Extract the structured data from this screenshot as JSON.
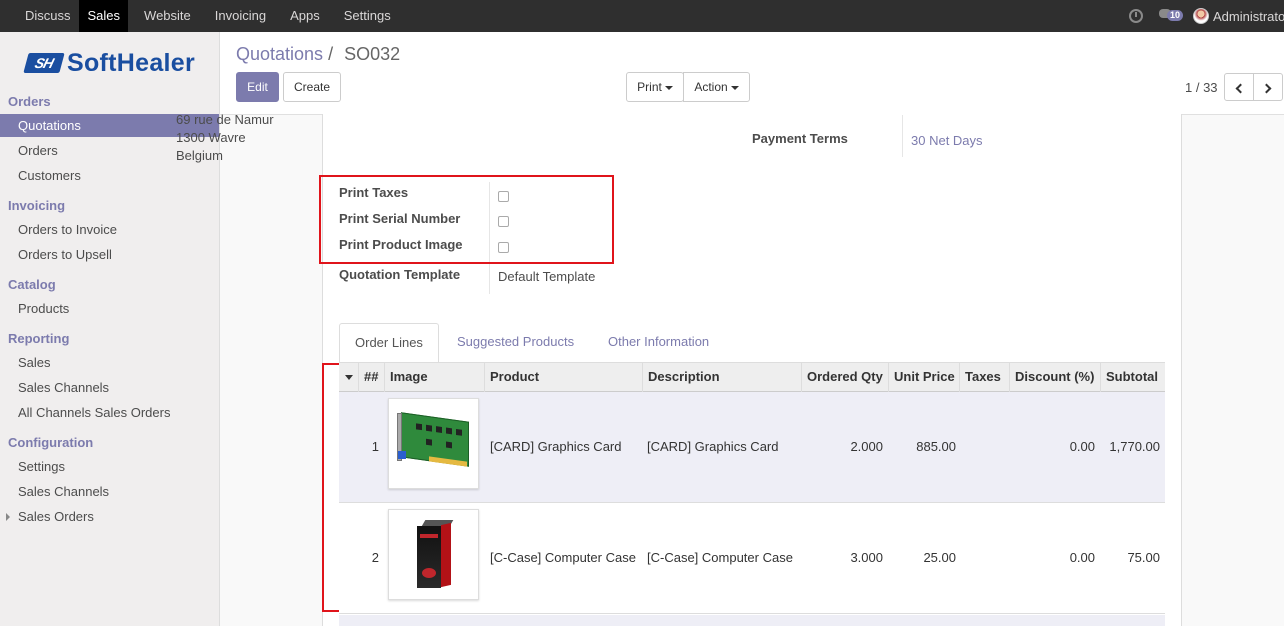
{
  "topbar": {
    "menu": [
      "Discuss",
      "Sales",
      "Website",
      "Invoicing",
      "Apps",
      "Settings"
    ],
    "active": "Sales",
    "chat_count": "10",
    "user": "Administrator"
  },
  "logo": {
    "mark": "SH",
    "text": "SoftHealer"
  },
  "sidebar": {
    "sections": [
      {
        "title": "Orders",
        "items": [
          "Quotations",
          "Orders",
          "Customers"
        ]
      },
      {
        "title": "Invoicing",
        "items": [
          "Orders to Invoice",
          "Orders to Upsell"
        ]
      },
      {
        "title": "Catalog",
        "items": [
          "Products"
        ]
      },
      {
        "title": "Reporting",
        "items": [
          "Sales",
          "Sales Channels",
          "All Channels Sales Orders"
        ]
      },
      {
        "title": "Configuration",
        "items": [
          "Settings",
          "Sales Channels",
          "Sales Orders"
        ]
      }
    ]
  },
  "breadcrumb": {
    "parent": "Quotations",
    "sep": "/",
    "current": "SO032"
  },
  "buttons": {
    "edit": "Edit",
    "create": "Create",
    "print": "Print",
    "action": "Action"
  },
  "pager": {
    "text": "1 / 33"
  },
  "form": {
    "address": [
      "69 rue de Namur",
      "1300 Wavre",
      "Belgium"
    ],
    "payment_terms_label": "Payment Terms",
    "payment_terms_value": "30 Net Days",
    "print_taxes_label": "Print Taxes",
    "print_serial_label": "Print Serial Number",
    "print_image_label": "Print Product Image",
    "template_label": "Quotation Template",
    "template_value": "Default Template"
  },
  "tabs": [
    "Order Lines",
    "Suggested Products",
    "Other Information"
  ],
  "table": {
    "headers": {
      "seq": "##",
      "image": "Image",
      "product": "Product",
      "description": "Description",
      "qty": "Ordered Qty",
      "price": "Unit Price",
      "taxes": "Taxes",
      "discount": "Discount (%)",
      "subtotal": "Subtotal"
    },
    "rows": [
      {
        "seq": "1",
        "product": "[CARD] Graphics Card",
        "description": "[CARD] Graphics Card",
        "qty": "2.000",
        "price": "885.00",
        "taxes": "",
        "discount": "0.00",
        "subtotal": "1,770.00"
      },
      {
        "seq": "2",
        "product": "[C-Case] Computer Case",
        "description": "[C-Case] Computer Case",
        "qty": "3.000",
        "price": "25.00",
        "taxes": "",
        "discount": "0.00",
        "subtotal": "75.00"
      }
    ]
  },
  "colors": {
    "brand": "#7c7bad",
    "highlight": "#e0141b",
    "topbar": "#2f2f2f"
  }
}
